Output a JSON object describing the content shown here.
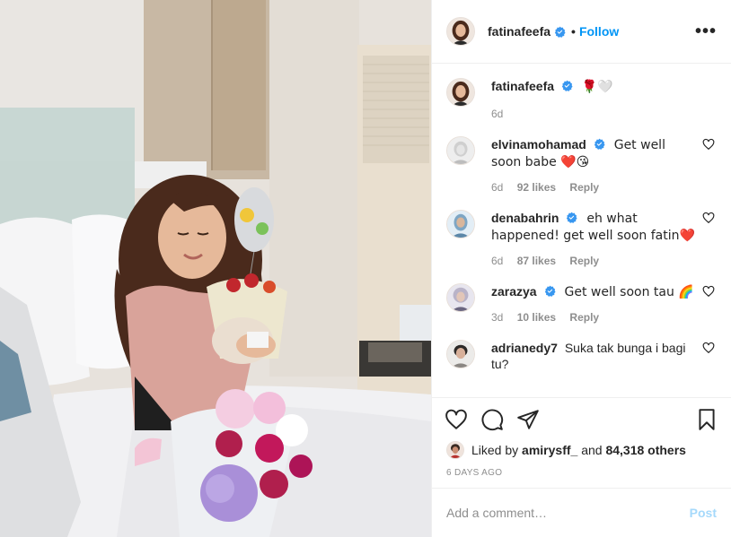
{
  "post": {
    "author": "fatinafeefa",
    "follow_label": "Follow",
    "more_glyph": "•••",
    "caption_emoji": "🌹🤍",
    "caption_age": "6d"
  },
  "comments": [
    {
      "user": "elvinamohamad",
      "text": "Get well soon babe ❤️😘",
      "age": "6d",
      "likes": "92 likes",
      "reply": "Reply"
    },
    {
      "user": "denabahrin",
      "text": "eh what happened! get well soon fatin❤️",
      "age": "6d",
      "likes": "87 likes",
      "reply": "Reply"
    },
    {
      "user": "zarazya",
      "text": "Get well soon tau 🌈",
      "age": "3d",
      "likes": "10 likes",
      "reply": "Reply"
    },
    {
      "user": "adrianedy7",
      "text": "Suka tak bunga i bagi tu?",
      "age": "",
      "likes": "",
      "reply": ""
    }
  ],
  "likes_line": {
    "prefix": "Liked by",
    "user": "amirysff_",
    "and": "and",
    "others": "84,318 others"
  },
  "time_ago": "6 days ago",
  "add_comment": {
    "placeholder": "Add a comment…",
    "post_label": "Post"
  },
  "colors": {
    "accent": "#0095f6",
    "verified": "#3897f0",
    "text": "#262626",
    "muted": "#8e8e8e"
  },
  "icons": [
    "verified-icon",
    "more-icon",
    "heart-icon",
    "comment-icon",
    "share-icon",
    "bookmark-icon"
  ]
}
